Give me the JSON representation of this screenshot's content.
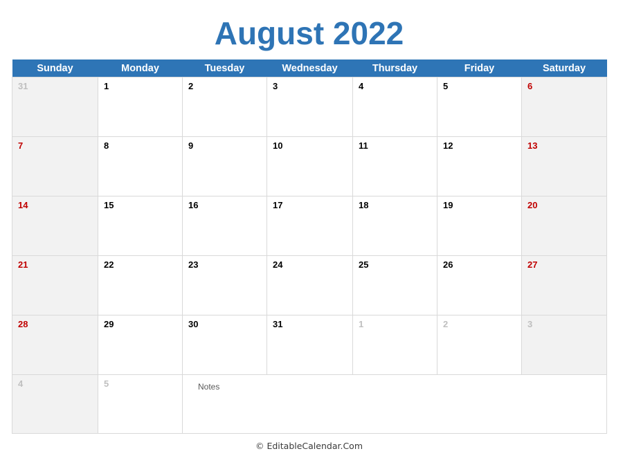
{
  "title": "August 2022",
  "colors": {
    "title": "#2E74B5",
    "header_bar": "#2E75B6",
    "header_text": "#FFFFFF",
    "weekend_background": "#F2F2F2",
    "weekend_number": "#C00000",
    "weekday_number": "#000000",
    "outside_month_number": "#BFBFBF",
    "grid_line": "#D9D9D9",
    "notes_label": "#595959"
  },
  "day_headers": [
    "Sunday",
    "Monday",
    "Tuesday",
    "Wednesday",
    "Thursday",
    "Friday",
    "Saturday"
  ],
  "weeks": [
    [
      {
        "num": "31",
        "in_month": false,
        "weekend": true
      },
      {
        "num": "1",
        "in_month": true,
        "weekend": false
      },
      {
        "num": "2",
        "in_month": true,
        "weekend": false
      },
      {
        "num": "3",
        "in_month": true,
        "weekend": false
      },
      {
        "num": "4",
        "in_month": true,
        "weekend": false
      },
      {
        "num": "5",
        "in_month": true,
        "weekend": false
      },
      {
        "num": "6",
        "in_month": true,
        "weekend": true
      }
    ],
    [
      {
        "num": "7",
        "in_month": true,
        "weekend": true
      },
      {
        "num": "8",
        "in_month": true,
        "weekend": false
      },
      {
        "num": "9",
        "in_month": true,
        "weekend": false
      },
      {
        "num": "10",
        "in_month": true,
        "weekend": false
      },
      {
        "num": "11",
        "in_month": true,
        "weekend": false
      },
      {
        "num": "12",
        "in_month": true,
        "weekend": false
      },
      {
        "num": "13",
        "in_month": true,
        "weekend": true
      }
    ],
    [
      {
        "num": "14",
        "in_month": true,
        "weekend": true
      },
      {
        "num": "15",
        "in_month": true,
        "weekend": false
      },
      {
        "num": "16",
        "in_month": true,
        "weekend": false
      },
      {
        "num": "17",
        "in_month": true,
        "weekend": false
      },
      {
        "num": "18",
        "in_month": true,
        "weekend": false
      },
      {
        "num": "19",
        "in_month": true,
        "weekend": false
      },
      {
        "num": "20",
        "in_month": true,
        "weekend": true
      }
    ],
    [
      {
        "num": "21",
        "in_month": true,
        "weekend": true
      },
      {
        "num": "22",
        "in_month": true,
        "weekend": false
      },
      {
        "num": "23",
        "in_month": true,
        "weekend": false
      },
      {
        "num": "24",
        "in_month": true,
        "weekend": false
      },
      {
        "num": "25",
        "in_month": true,
        "weekend": false
      },
      {
        "num": "26",
        "in_month": true,
        "weekend": false
      },
      {
        "num": "27",
        "in_month": true,
        "weekend": true
      }
    ],
    [
      {
        "num": "28",
        "in_month": true,
        "weekend": true
      },
      {
        "num": "29",
        "in_month": true,
        "weekend": false
      },
      {
        "num": "30",
        "in_month": true,
        "weekend": false
      },
      {
        "num": "31",
        "in_month": true,
        "weekend": false
      },
      {
        "num": "1",
        "in_month": false,
        "weekend": false
      },
      {
        "num": "2",
        "in_month": false,
        "weekend": false
      },
      {
        "num": "3",
        "in_month": false,
        "weekend": true
      }
    ]
  ],
  "last_row": {
    "days": [
      {
        "num": "4",
        "in_month": false,
        "weekend": true
      },
      {
        "num": "5",
        "in_month": false,
        "weekend": false
      }
    ],
    "notes_label": "Notes"
  },
  "footer": "© EditableCalendar.Com"
}
